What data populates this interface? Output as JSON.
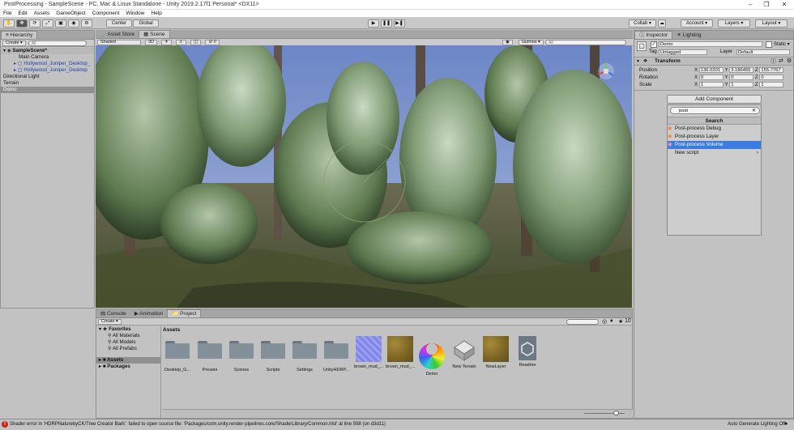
{
  "window": {
    "title": "PostProcessing - SampleScene - PC, Mac & Linux Standalone - Unity 2019.2.17f1 Personal* <DX11>",
    "minimize": "–",
    "maximize": "❐",
    "close": "✕"
  },
  "menu": [
    "File",
    "Edit",
    "Assets",
    "GameObject",
    "Component",
    "Window",
    "Help"
  ],
  "toolbar": {
    "pivot": "Center",
    "space": "Global",
    "collab": "Collab ▾",
    "account": "Account ▾",
    "layers": "Layers ▾",
    "layout": "Layout ▾"
  },
  "hierarchy": {
    "tab": "Hierarchy",
    "create": "Create ▾",
    "search_placeholder": "All",
    "scene": "SampleScene*",
    "items": [
      {
        "label": "Main Camera",
        "type": "object"
      },
      {
        "label": "Hollywood_Juniper_Desktop_",
        "type": "prefab"
      },
      {
        "label": "Hollywood_Juniper_Desktop",
        "type": "prefab"
      },
      {
        "label": "Directional Light",
        "type": "object"
      },
      {
        "label": "Terrain",
        "type": "object"
      },
      {
        "label": "Demo",
        "type": "selected"
      }
    ]
  },
  "scene_tabs": {
    "asset_store": "Asset Store",
    "scene": "Scene"
  },
  "scene_bar": {
    "shading": "Shaded",
    "mode_2d": "2D",
    "fx_count": "0",
    "gizmos": "Gizmos ▾",
    "search_placeholder": "All"
  },
  "project": {
    "tabs": [
      "Console",
      "Animation",
      "Project"
    ],
    "create": "Create ▾",
    "favorites_label": "Favorites",
    "favorites": [
      "All Materials",
      "All Models",
      "All Prefabs"
    ],
    "tree": [
      "Assets",
      "Packages"
    ],
    "assets_header": "Assets",
    "hidden_count": "10",
    "assets": [
      {
        "label": "Desktop_G...",
        "kind": "folder"
      },
      {
        "label": "Presets",
        "kind": "folder"
      },
      {
        "label": "Scenes",
        "kind": "folder"
      },
      {
        "label": "Scripts",
        "kind": "folder"
      },
      {
        "label": "Settings",
        "kind": "folder"
      },
      {
        "label": "UnityHDRP...",
        "kind": "folder"
      },
      {
        "label": "brown_mud_...",
        "kind": "normalmap"
      },
      {
        "label": "brown_mud_...",
        "kind": "texture"
      },
      {
        "label": "Demo",
        "kind": "colorwheel"
      },
      {
        "label": "New Terrain",
        "kind": "terrain"
      },
      {
        "label": "NewLayer",
        "kind": "texture"
      },
      {
        "label": "Readme",
        "kind": "unity"
      }
    ]
  },
  "inspector": {
    "tabs": [
      "Inspector",
      "Lighting"
    ],
    "object_name": "Demo",
    "static_label": "Static ▾",
    "tag_label": "Tag",
    "tag_value": "Untagged",
    "layer_label": "Layer",
    "layer_value": "Default",
    "transform": {
      "title": "Transform",
      "rows": [
        {
          "label": "Position",
          "x": "136.0201",
          "y": "3.186455",
          "z": "155.7767"
        },
        {
          "label": "Rotation",
          "x": "0",
          "y": "0",
          "z": "0"
        },
        {
          "label": "Scale",
          "x": "1",
          "y": "1",
          "z": "1"
        }
      ]
    },
    "add_component": "Add Component",
    "search_value": "post",
    "search_header": "Search",
    "results": [
      {
        "label": "Post-process Debug",
        "selected": false
      },
      {
        "label": "Post-process Layer",
        "selected": false
      },
      {
        "label": "Post-process Volume",
        "selected": true
      },
      {
        "label": "New script",
        "selected": false
      }
    ]
  },
  "status": {
    "error": "Shader error in 'HDRPNaturebyCK/Tree Creator Bark': failed to open source file: 'Packages/com.unity.render-pipelines.core/ShaderLibrary/Common.hlsl' at line 598 (on d3d11)",
    "lighting": "Auto Generate Lighting Off"
  },
  "colors": {
    "selection": "#3b7ce3",
    "error": "#d0201a",
    "prefab": "#1d3fa6"
  }
}
